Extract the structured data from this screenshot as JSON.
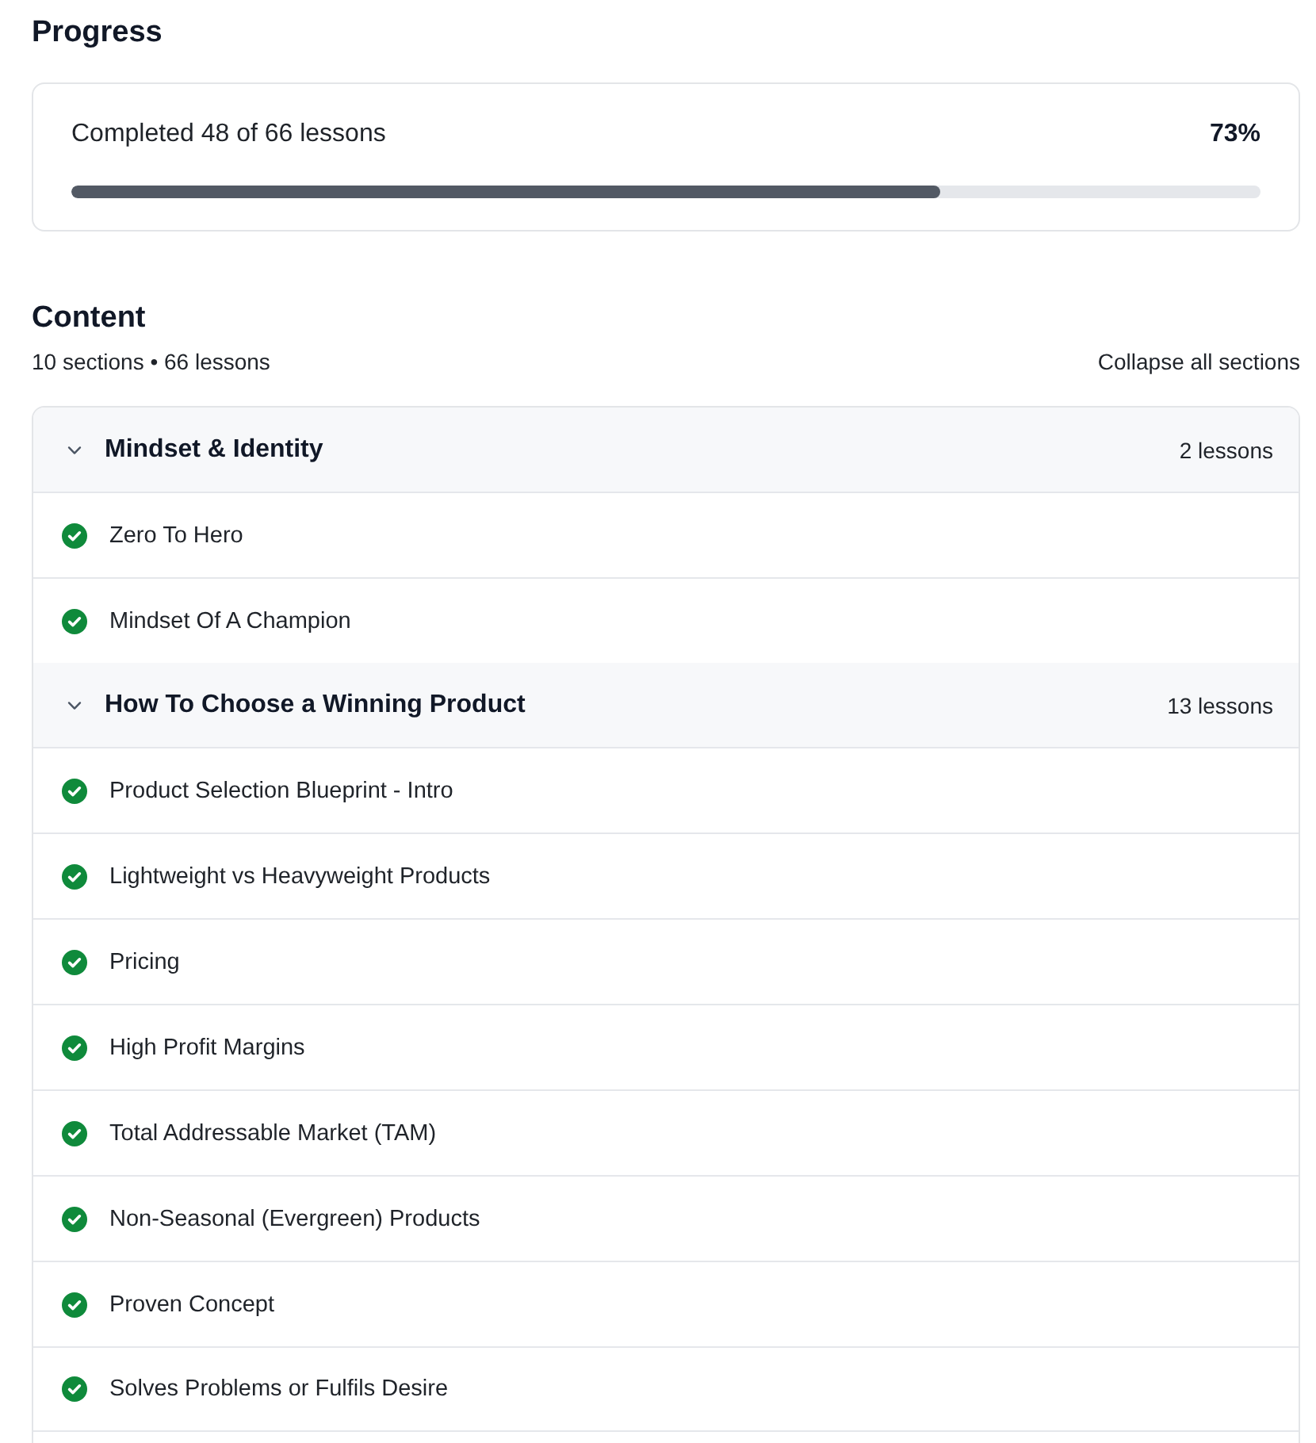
{
  "progress": {
    "title": "Progress",
    "summary": "Completed 48 of 66 lessons",
    "percent": "73%",
    "level": 0.73
  },
  "content": {
    "title": "Content",
    "subtitle": "10 sections • 66 lessons",
    "collapse_label": "Collapse all sections",
    "sections": [
      {
        "title": "Mindset & Identity",
        "count": "2 lessons",
        "expanded": true,
        "lessons": [
          {
            "title": "Zero To Hero",
            "completed": true
          },
          {
            "title": "Mindset Of A Champion",
            "completed": true
          }
        ]
      },
      {
        "title": "How To Choose a Winning Product",
        "count": "13 lessons",
        "expanded": true,
        "lessons": [
          {
            "title": "Product Selection Blueprint - Intro",
            "completed": true
          },
          {
            "title": "Lightweight vs Heavyweight Products",
            "completed": true
          },
          {
            "title": "Pricing",
            "completed": true
          },
          {
            "title": "High Profit Margins",
            "completed": true
          },
          {
            "title": "Total Addressable Market (TAM)",
            "completed": true
          },
          {
            "title": "Non-Seasonal (Evergreen) Products",
            "completed": true
          },
          {
            "title": "Proven Concept",
            "completed": true
          },
          {
            "title": "Solves Problems or Fulfils Desire",
            "completed": true
          }
        ]
      }
    ]
  }
}
